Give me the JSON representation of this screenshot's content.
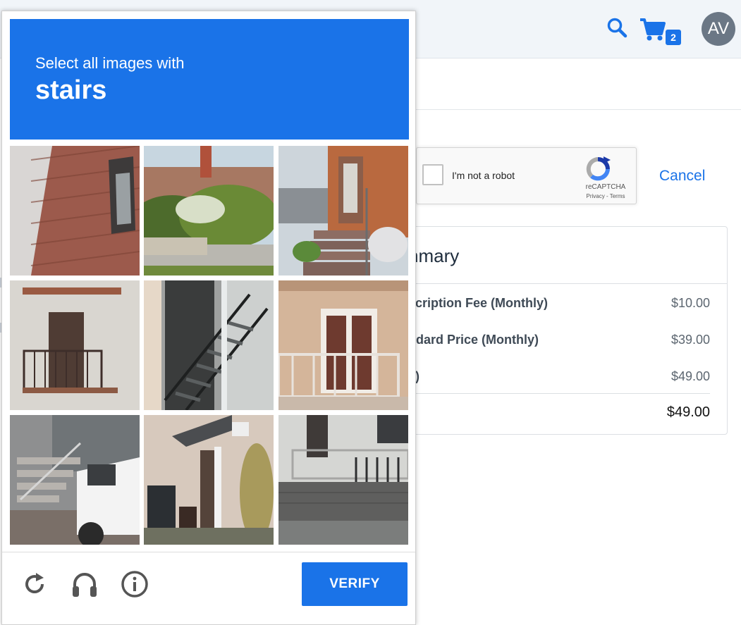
{
  "header": {
    "cart_count": "2",
    "avatar_initials": "AV"
  },
  "recaptcha": {
    "label": "I'm not a robot",
    "brand": "reCAPTCHA",
    "links": "Privacy - Terms"
  },
  "cancel_label": "Cancel",
  "summary": {
    "title": "nmary",
    "rows": [
      {
        "label": "scription Fee (Monthly)",
        "value": "$10.00"
      },
      {
        "label": "ndard Price (Monthly)",
        "value": "$39.00"
      },
      {
        "label": "y)",
        "value": "$49.00"
      }
    ],
    "total": "$49.00"
  },
  "captcha": {
    "instruction": "Select all images with",
    "target": "stairs",
    "verify_label": "VERIFY",
    "tiles": [
      {
        "subject": "brick wall with window"
      },
      {
        "subject": "house with hedge and bushes"
      },
      {
        "subject": "outdoor steps with railing"
      },
      {
        "subject": "balcony with iron railing"
      },
      {
        "subject": "metal fire escape stairs"
      },
      {
        "subject": "balcony with door"
      },
      {
        "subject": "steps and white car"
      },
      {
        "subject": "house entrance with steps"
      },
      {
        "subject": "porch with railing"
      }
    ]
  },
  "colors": {
    "accent": "#1a73e8",
    "topbar": "#f1f5f9",
    "avatar": "#6b7785"
  }
}
